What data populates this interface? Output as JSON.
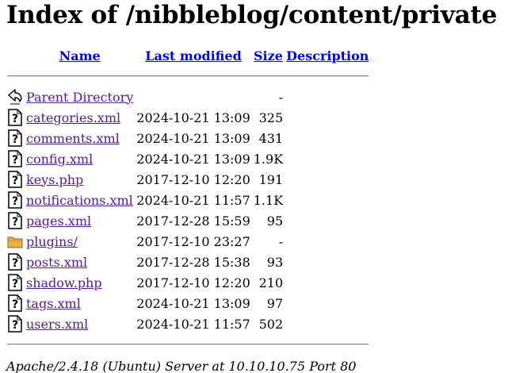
{
  "page": {
    "title": "Index of /nibbleblog/content/private"
  },
  "columns": {
    "name": "Name",
    "last_modified": "Last modified",
    "size": "Size",
    "description": "Description"
  },
  "parent": {
    "label": "Parent Directory",
    "size": "-",
    "icon": "back-arrow-icon"
  },
  "entries": [
    {
      "name": "categories.xml",
      "modified": "2024-10-21 13:09",
      "size": "325",
      "icon": "unknown-file-icon"
    },
    {
      "name": "comments.xml",
      "modified": "2024-10-21 13:09",
      "size": "431",
      "icon": "unknown-file-icon"
    },
    {
      "name": "config.xml",
      "modified": "2024-10-21 13:09",
      "size": "1.9K",
      "icon": "unknown-file-icon"
    },
    {
      "name": "keys.php",
      "modified": "2017-12-10 12:20",
      "size": "191",
      "icon": "unknown-file-icon"
    },
    {
      "name": "notifications.xml",
      "modified": "2024-10-21 11:57",
      "size": "1.1K",
      "icon": "unknown-file-icon"
    },
    {
      "name": "pages.xml",
      "modified": "2017-12-28 15:59",
      "size": "95",
      "icon": "unknown-file-icon"
    },
    {
      "name": "plugins/",
      "modified": "2017-12-10 23:27",
      "size": "-",
      "icon": "folder-icon"
    },
    {
      "name": "posts.xml",
      "modified": "2017-12-28 15:38",
      "size": "93",
      "icon": "unknown-file-icon"
    },
    {
      "name": "shadow.php",
      "modified": "2017-12-10 12:20",
      "size": "210",
      "icon": "unknown-file-icon"
    },
    {
      "name": "tags.xml",
      "modified": "2024-10-21 13:09",
      "size": "97",
      "icon": "unknown-file-icon"
    },
    {
      "name": "users.xml",
      "modified": "2024-10-21 11:57",
      "size": "502",
      "icon": "unknown-file-icon"
    }
  ],
  "footer": {
    "signature": "Apache/2.4.18 (Ubuntu) Server at 10.10.10.75 Port 80"
  },
  "colors": {
    "link_visited": "#551a8b",
    "link_header": "#0000ee",
    "folder": "#e8b04a"
  }
}
